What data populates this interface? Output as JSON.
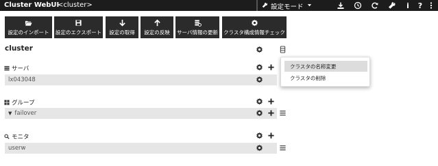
{
  "app": {
    "title": "Cluster WebUI",
    "cluster_tag": "<cluster>",
    "mode": "設定モード"
  },
  "toolbar": {
    "buttons": [
      {
        "label": "設定のインポート",
        "icon": "folder-open-icon"
      },
      {
        "label": "設定のエクスポート",
        "icon": "save-icon"
      },
      {
        "label": "設定の取得",
        "icon": "arrow-down-icon"
      },
      {
        "label": "設定の反映",
        "icon": "arrow-up-icon"
      },
      {
        "label": "サーバ情報の更新",
        "icon": "server-refresh-icon"
      },
      {
        "label": "クラスタ構成情報チェック",
        "icon": "gear-icon"
      }
    ]
  },
  "main": {
    "cluster_name": "cluster",
    "servers": {
      "title": "サーバ",
      "items": [
        "lx043048"
      ]
    },
    "groups": {
      "title": "グループ",
      "items": [
        "failover"
      ]
    },
    "monitors": {
      "title": "モニタ",
      "items": [
        "userw"
      ]
    }
  },
  "context_menu": {
    "items": [
      "クラスタの名称変更",
      "クラスタの削除"
    ]
  },
  "colors": {
    "topbar_bg": "#1c1c1c",
    "button_bg": "#2b2b2b",
    "row_bg": "#e6e6e6",
    "menu_highlight": "#dcdcdc"
  }
}
